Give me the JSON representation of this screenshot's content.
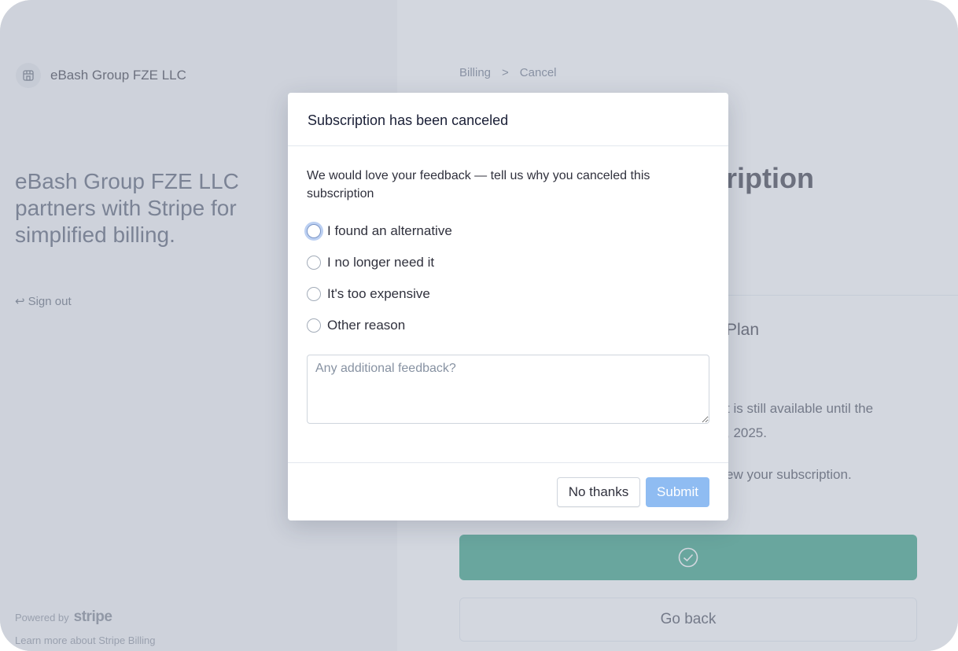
{
  "left_panel": {
    "merchant_name": "eBash Group FZE LLC",
    "tagline": "eBash Group FZE LLC partners with Stripe for simplified billing.",
    "sign_out_label": "Sign out",
    "powered_by_label": "Powered by",
    "stripe_brand": "stripe",
    "learn_more_label": "Learn more about Stripe Billing"
  },
  "right_panel": {
    "breadcrumb": [
      "Billing",
      "Cancel"
    ],
    "breadcrumb_separator": ">",
    "page_title": "ription",
    "plan_fragment": "Plan",
    "info_line1": "t is still available until the",
    "info_line2": ", 2025.",
    "renew_fragment": "ew your subscription.",
    "go_back_label": "Go back"
  },
  "modal": {
    "title": "Subscription has been canceled",
    "prompt": "We would love your feedback — tell us why you canceled this subscription",
    "options": [
      {
        "label": "I found an alternative"
      },
      {
        "label": "I no longer need it"
      },
      {
        "label": "It's too expensive"
      },
      {
        "label": "Other reason"
      }
    ],
    "feedback_placeholder": "Any additional feedback?",
    "no_thanks_label": "No thanks",
    "submit_label": "Submit"
  },
  "colors": {
    "accent": "#2a9d7d",
    "submit": "#8fbcf2"
  },
  "icons": {
    "merchant_logo": "storefront-icon",
    "sign_out": "sign-out-arrow-icon",
    "confirm": "check-circle-icon"
  }
}
